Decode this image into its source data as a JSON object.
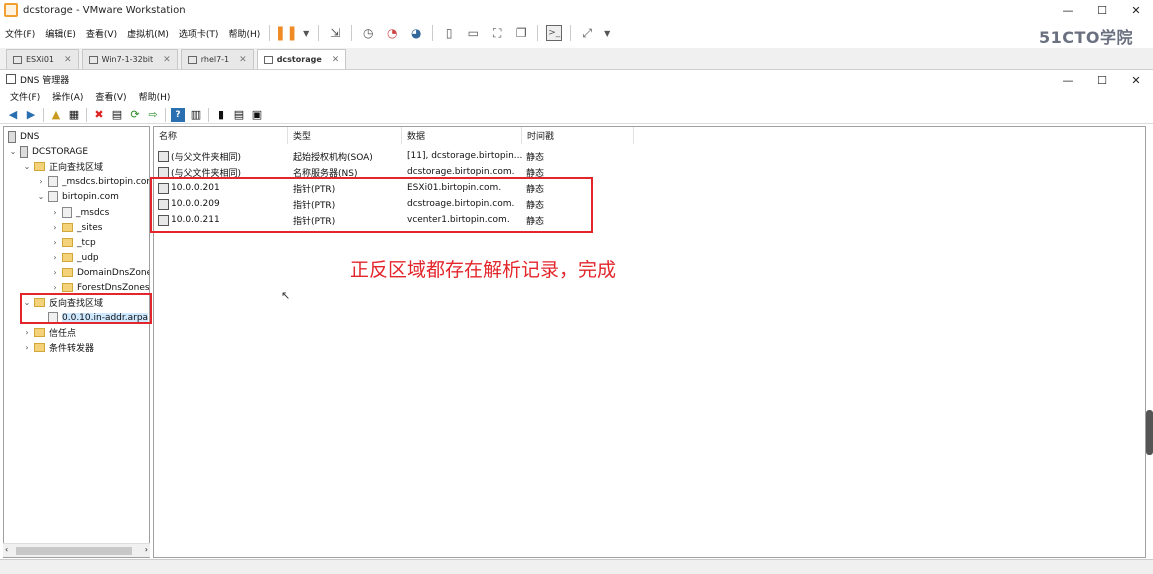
{
  "window": {
    "title": "dcstorage - VMware Workstation",
    "minimize": "—",
    "maximize": "☐",
    "close": "✕"
  },
  "brand": "51CTO学院",
  "vm_menu": [
    "文件(F)",
    "编辑(E)",
    "查看(V)",
    "虚拟机(M)",
    "选项卡(T)",
    "帮助(H)"
  ],
  "vm_tabs": [
    {
      "label": "ESXi01"
    },
    {
      "label": "Win7-1-32bit"
    },
    {
      "label": "rhel7-1"
    },
    {
      "label": "dcstorage"
    }
  ],
  "dns_window": {
    "title": "DNS 管理器",
    "minimize": "—",
    "maximize": "☐",
    "close": "✕"
  },
  "dns_menu": [
    "文件(F)",
    "操作(A)",
    "查看(V)",
    "帮助(H)"
  ],
  "tree": {
    "root": "DNS",
    "server": "DCSTORAGE",
    "forward": "正向查找区域",
    "msdcs_zone": "_msdcs.birtopin.com",
    "birtopin": "birtopin.com",
    "children": [
      "_msdcs",
      "_sites",
      "_tcp",
      "_udp",
      "DomainDnsZones",
      "ForestDnsZones"
    ],
    "reverse": "反向查找区域",
    "reverse_zone": "0.0.10.in-addr.arpa",
    "trust": "信任点",
    "forwarders": "条件转发器"
  },
  "list": {
    "headers": [
      "名称",
      "类型",
      "数据",
      "时间戳"
    ],
    "rows": [
      {
        "name": "(与父文件夹相同)",
        "type": "起始授权机构(SOA)",
        "data": "[11], dcstorage.birtopin...",
        "ts": "静态"
      },
      {
        "name": "(与父文件夹相同)",
        "type": "名称服务器(NS)",
        "data": "dcstorage.birtopin.com.",
        "ts": "静态"
      },
      {
        "name": "10.0.0.201",
        "type": "指针(PTR)",
        "data": "ESXi01.birtopin.com.",
        "ts": "静态"
      },
      {
        "name": "10.0.0.209",
        "type": "指针(PTR)",
        "data": "dcstroage.birtopin.com.",
        "ts": "静态"
      },
      {
        "name": "10.0.0.211",
        "type": "指针(PTR)",
        "data": "vcenter1.birtopin.com.",
        "ts": "静态"
      }
    ]
  },
  "annotation": "正反区域都存在解析记录，完成",
  "colors": {
    "highlight": "#e3262c",
    "accent_pause": "#f08a24"
  }
}
